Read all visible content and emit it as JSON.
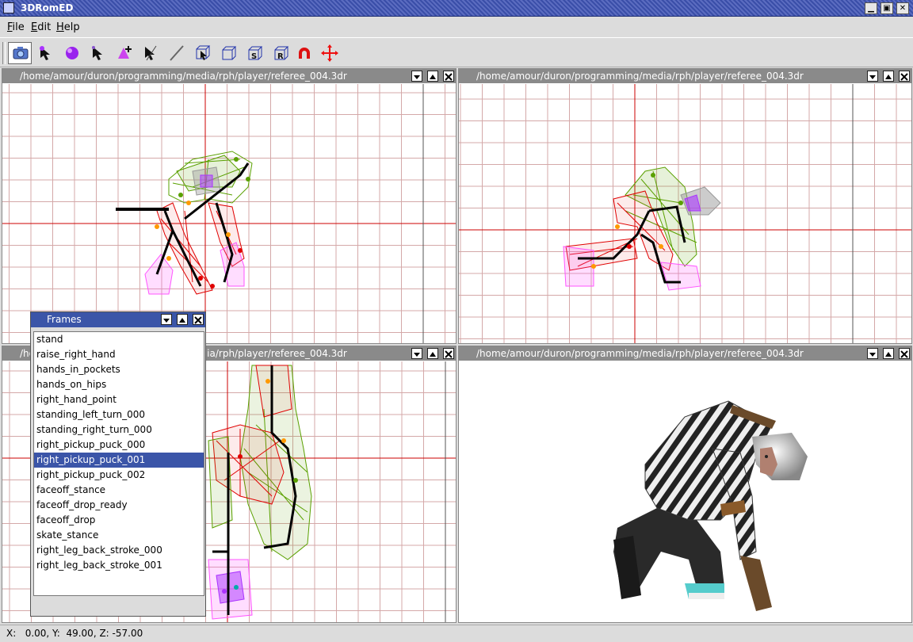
{
  "window": {
    "title": "3DRomED",
    "minimize_glyph": "▁",
    "maximize_glyph": "▣",
    "close_glyph": "✕"
  },
  "menu": {
    "items": [
      "File",
      "Edit",
      "Help"
    ]
  },
  "toolbar": {
    "tools": [
      {
        "icon": "camera-icon"
      },
      {
        "icon": "select-vertex-icon"
      },
      {
        "icon": "sphere-icon"
      },
      {
        "icon": "select-arrow-icon"
      },
      {
        "icon": "add-triangle-icon"
      },
      {
        "icon": "pick-arrow-icon"
      },
      {
        "icon": "line-tool-icon"
      },
      {
        "icon": "select-box-icon"
      },
      {
        "icon": "box-icon"
      },
      {
        "icon": "scale-box-icon",
        "letter": "S"
      },
      {
        "icon": "rotate-box-icon",
        "letter": "R"
      },
      {
        "icon": "magnet-icon"
      },
      {
        "icon": "move-icon"
      }
    ]
  },
  "viewports": [
    {
      "title": "/home/amour/duron/programming/media/rph/player/referee_004.3dr"
    },
    {
      "title": "/home/amour/duron/programming/media/rph/player/referee_004.3dr"
    },
    {
      "title": "/home/amour/duron/programming/media/rph/player/referee_004.3dr"
    },
    {
      "title": "/home/amour/duron/programming/media/rph/player/referee_004.3dr"
    }
  ],
  "frames_dialog": {
    "title": "Frames",
    "items": [
      "stand",
      "raise_right_hand",
      "hands_in_pockets",
      "hands_on_hips",
      "right_hand_point",
      "standing_left_turn_000",
      "standing_right_turn_000",
      "right_pickup_puck_000",
      "right_pickup_puck_001",
      "right_pickup_puck_002",
      "faceoff_stance",
      "faceoff_drop_ready",
      "faceoff_drop",
      "skate_stance",
      "right_leg_back_stroke_000",
      "right_leg_back_stroke_001"
    ],
    "selected": "right_pickup_puck_001"
  },
  "status": {
    "coords": "X:   0.00, Y:  49.00, Z: -57.00"
  },
  "colors": {
    "grid": "#d4a8a8",
    "axis": "#cc0000",
    "mesh_green": "#5aa000",
    "mesh_red": "#e00000",
    "mesh_pink": "#ff55ff",
    "mesh_gray": "#999999",
    "bone": "#000000",
    "joint_orange": "#ff9900",
    "selection": "#3b55a8"
  }
}
